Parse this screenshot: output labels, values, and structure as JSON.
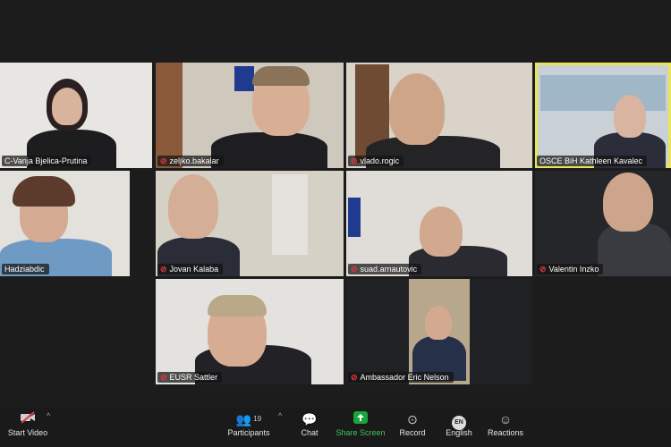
{
  "participants": [
    {
      "name": "C-Vanja Bjelica-Prutina"
    },
    {
      "name": "zeljko.bakalar"
    },
    {
      "name": "vlado.rogic"
    },
    {
      "name": "OSCE BiH Kathleen Kavalec"
    },
    {
      "name": "Hadziabdic"
    },
    {
      "name": "Jovan Kalaba"
    },
    {
      "name": "suad.arnautovic"
    },
    {
      "name": "Valentin Inzko"
    },
    {
      "name": "EUSR Sattler"
    },
    {
      "name": "Ambassador Eric Nelson"
    }
  ],
  "toolbar": {
    "start_video": "Start Video",
    "participants": "Participants",
    "participants_count": "19",
    "chat": "Chat",
    "share_screen": "Share Screen",
    "record": "Record",
    "english": "English",
    "english_badge": "EN",
    "reactions": "Reactions"
  },
  "colors": {
    "active_speaker": "#e9e45a",
    "share": "#18a53a",
    "muted": "#e0383e"
  }
}
